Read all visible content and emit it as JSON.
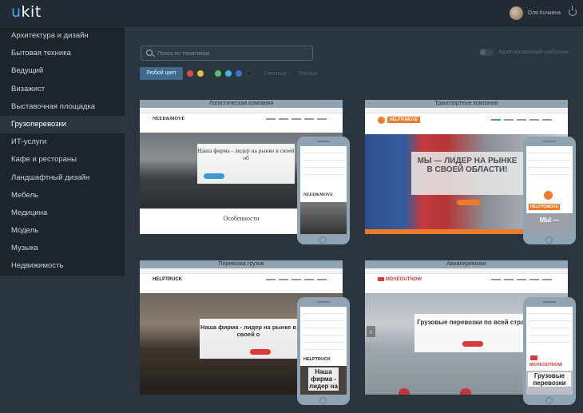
{
  "header": {
    "logo_u": "u",
    "logo_rest": "kit",
    "username": "Оля Кочкина"
  },
  "sidebar": {
    "items": [
      {
        "label": "Архитектура и дизайн"
      },
      {
        "label": "Бытовая техника"
      },
      {
        "label": "Ведущий"
      },
      {
        "label": "Визажист"
      },
      {
        "label": "Выставочная площадка"
      },
      {
        "label": "Грузоперевозки",
        "active": true
      },
      {
        "label": "ИТ-услуги"
      },
      {
        "label": "Кафе и рестораны"
      },
      {
        "label": "Ландшафтный дизайн"
      },
      {
        "label": "Мебель"
      },
      {
        "label": "Медицина"
      },
      {
        "label": "Модель"
      },
      {
        "label": "Музыка"
      },
      {
        "label": "Недвижимость"
      }
    ]
  },
  "filters": {
    "search_placeholder": "Поиск по тематикам",
    "toggle_label": "Адаптированные шаблоны",
    "any_color": "Любой цвет",
    "swatches": [
      "#d94b4b",
      "#e8c23a",
      "#5bbf6a",
      "#49b3d6",
      "#3b6fd1",
      "#222a33"
    ],
    "tones": [
      "Светлые",
      "Темные"
    ]
  },
  "cards": [
    {
      "caption": "Логистическая компания",
      "brand": "NEED&MOVE",
      "hero_title": "Наша фирма - лидер на рынке в своей об",
      "below_text": "Особенности",
      "phone_brand": "NEED&MOVE"
    },
    {
      "caption": "Транспортные компании",
      "brand": "HELPTOMOVE",
      "hero_title": "МЫ — ЛИДЕР НА РЫНКЕ В СВОЕЙ ОБЛАСТИ!",
      "phone_brand": "HELPTOMOVE",
      "phone_text": "МЫ —"
    },
    {
      "caption": "Перевозка грузов",
      "brand": "HELPTRUCK",
      "hero_title": "Наша фирма - лидер на рынке в своей о",
      "phone_brand": "HELPTRUCK",
      "phone_text": "Наша фирма - лидер на"
    },
    {
      "caption": "Авиаперевозки",
      "brand": "MOVEOUTNOW",
      "hero_title": "Грузовые перевозки по всей стране",
      "phone_brand": "MOVEOUTNOW",
      "phone_text": "Грузовые перевозки"
    }
  ]
}
